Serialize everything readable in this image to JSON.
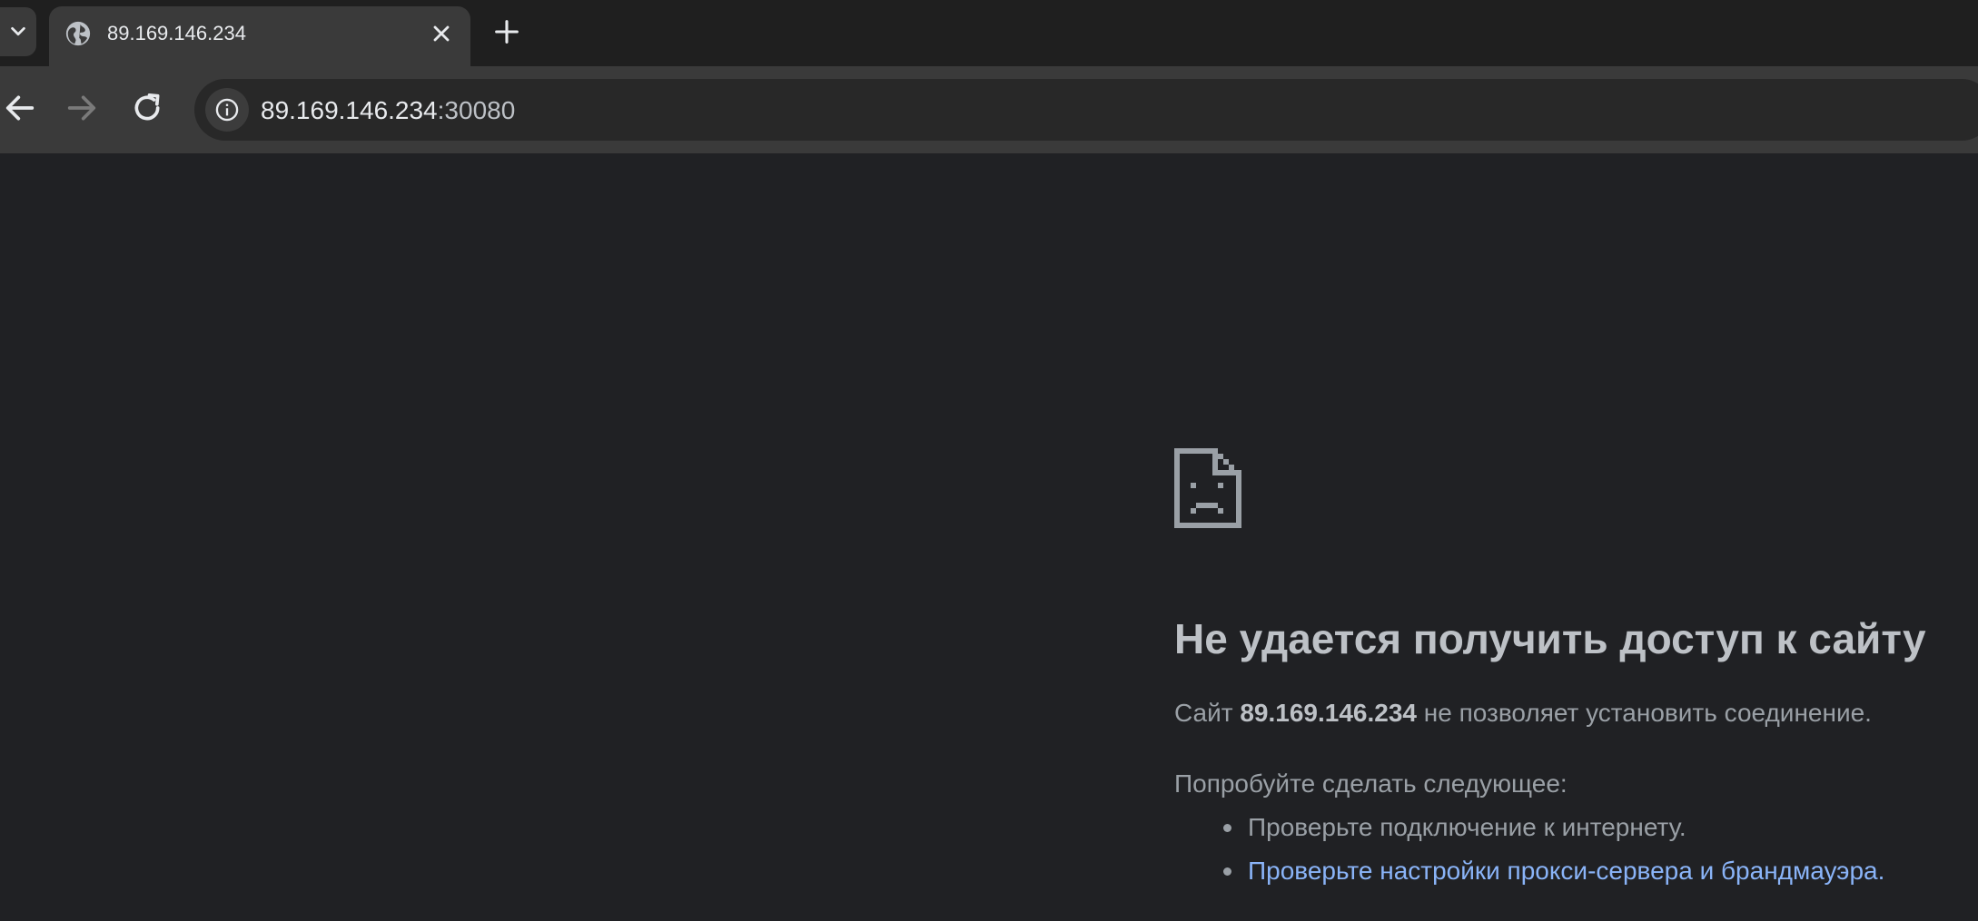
{
  "tab": {
    "title": "89.169.146.234"
  },
  "address_bar": {
    "host": "89.169.146.234",
    "port": ":30080"
  },
  "error": {
    "title": "Не удается получить доступ к сайту",
    "desc_prefix": "Сайт ",
    "desc_host": "89.169.146.234",
    "desc_suffix": " не позволяет установить соединение.",
    "suggestions_heading": "Попробуйте сделать следующее:",
    "suggestions": [
      "Проверьте подключение к интернету.",
      "Проверьте настройки прокси-сервера и брандмауэра"
    ],
    "suggestion_link_trailing": "."
  },
  "icons": {
    "tab_search": "chevron-down-icon",
    "favicon": "globe-icon",
    "tab_close": "close-icon",
    "new_tab": "plus-icon",
    "back": "back-arrow-icon",
    "forward": "forward-arrow-icon",
    "reload": "reload-icon",
    "site_info": "info-icon",
    "error": "sad-page-icon"
  },
  "colors": {
    "background": "#202124",
    "link": "#8ab4f8",
    "title_text": "#bdc1c6",
    "body_text": "#9aa0a6"
  }
}
